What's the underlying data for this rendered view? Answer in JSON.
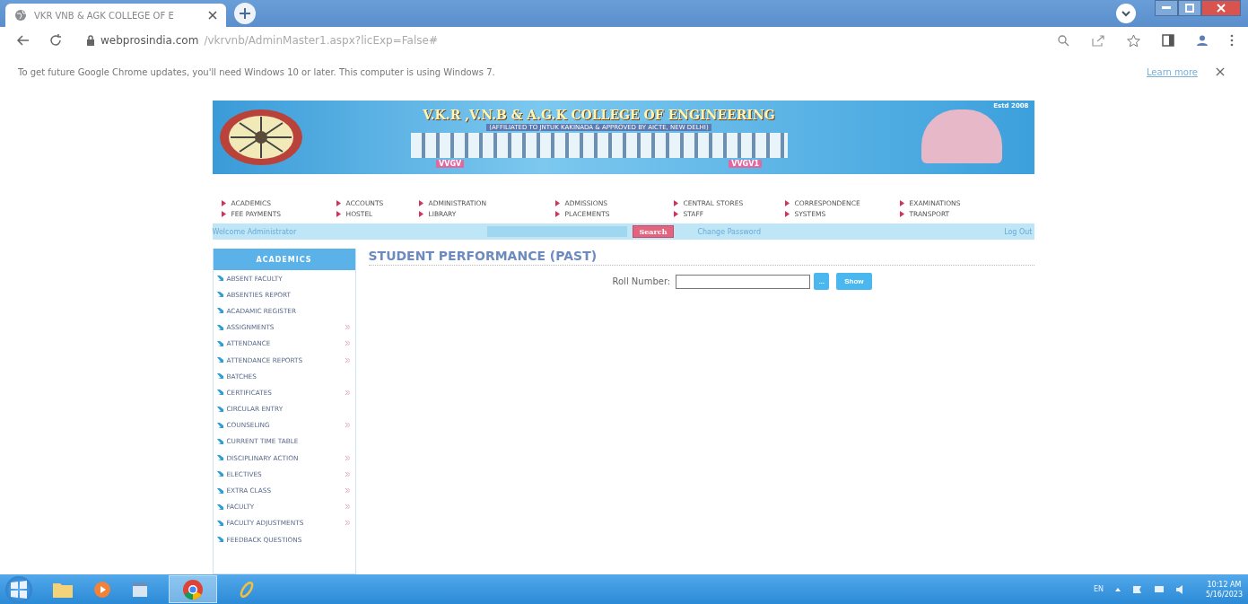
{
  "browser": {
    "tab_title": "VKR VNB & AGK COLLEGE OF E",
    "url_host": "webprosindia.com",
    "url_path": "/vkrvnb/AdminMaster1.aspx?licExp=False#"
  },
  "infobar": {
    "message": "To get future Google Chrome updates, you'll need Windows 10 or later. This computer is using Windows 7.",
    "link": "Learn more"
  },
  "banner": {
    "title": "V.K.R ,V.N.B & A.G.K COLLEGE OF ENGINEERING",
    "subtitle": "(AFFILIATED TO JNTUK KAKINADA & APPROVED BY AICTE, NEW DELHI)",
    "estd": "Estd 2008",
    "code_left": "VVGV",
    "code_right": "VVGV1"
  },
  "nav": [
    [
      "ACADEMICS",
      "ACCOUNTS",
      "ADMINISTRATION",
      "ADMISSIONS",
      "CENTRAL STORES",
      "CORRESPONDENCE",
      "EXAMINATIONS"
    ],
    [
      "FEE PAYMENTS",
      "HOSTEL",
      "LIBRARY",
      "PLACEMENTS",
      "STAFF",
      "SYSTEMS",
      "TRANSPORT"
    ]
  ],
  "welcome_bar": {
    "welcome": "Welcome Administrator",
    "search_button": "Search",
    "change_password": "Change Password",
    "logout": "Log Out"
  },
  "sidebar": {
    "heading": "ACADEMICS",
    "items": [
      {
        "label": "ABSENT FACULTY",
        "has_submenu": false
      },
      {
        "label": "ABSENTIES REPORT",
        "has_submenu": false
      },
      {
        "label": "ACADAMIC REGISTER",
        "has_submenu": false
      },
      {
        "label": "ASSIGNMENTS",
        "has_submenu": true
      },
      {
        "label": "ATTENDANCE",
        "has_submenu": true
      },
      {
        "label": "ATTENDANCE REPORTS",
        "has_submenu": true
      },
      {
        "label": "BATCHES",
        "has_submenu": false
      },
      {
        "label": "CERTIFICATES",
        "has_submenu": true
      },
      {
        "label": "CIRCULAR ENTRY",
        "has_submenu": false
      },
      {
        "label": "COUNSELING",
        "has_submenu": true
      },
      {
        "label": "CURRENT TIME TABLE",
        "has_submenu": false
      },
      {
        "label": "DISCIPLINARY ACTION",
        "has_submenu": true
      },
      {
        "label": "ELECTIVES",
        "has_submenu": true
      },
      {
        "label": "EXTRA CLASS",
        "has_submenu": true
      },
      {
        "label": "FACULTY",
        "has_submenu": true
      },
      {
        "label": "FACULTY ADJUSTMENTS",
        "has_submenu": true
      },
      {
        "label": "FEEDBACK QUESTIONS",
        "has_submenu": false
      }
    ]
  },
  "content": {
    "title": "STUDENT PERFORMANCE (PAST)",
    "roll_label": "Roll Number:",
    "browse_button": "...",
    "show_button": "Show"
  },
  "taskbar": {
    "language": "EN",
    "time": "10:12 AM",
    "date": "5/16/2023"
  }
}
